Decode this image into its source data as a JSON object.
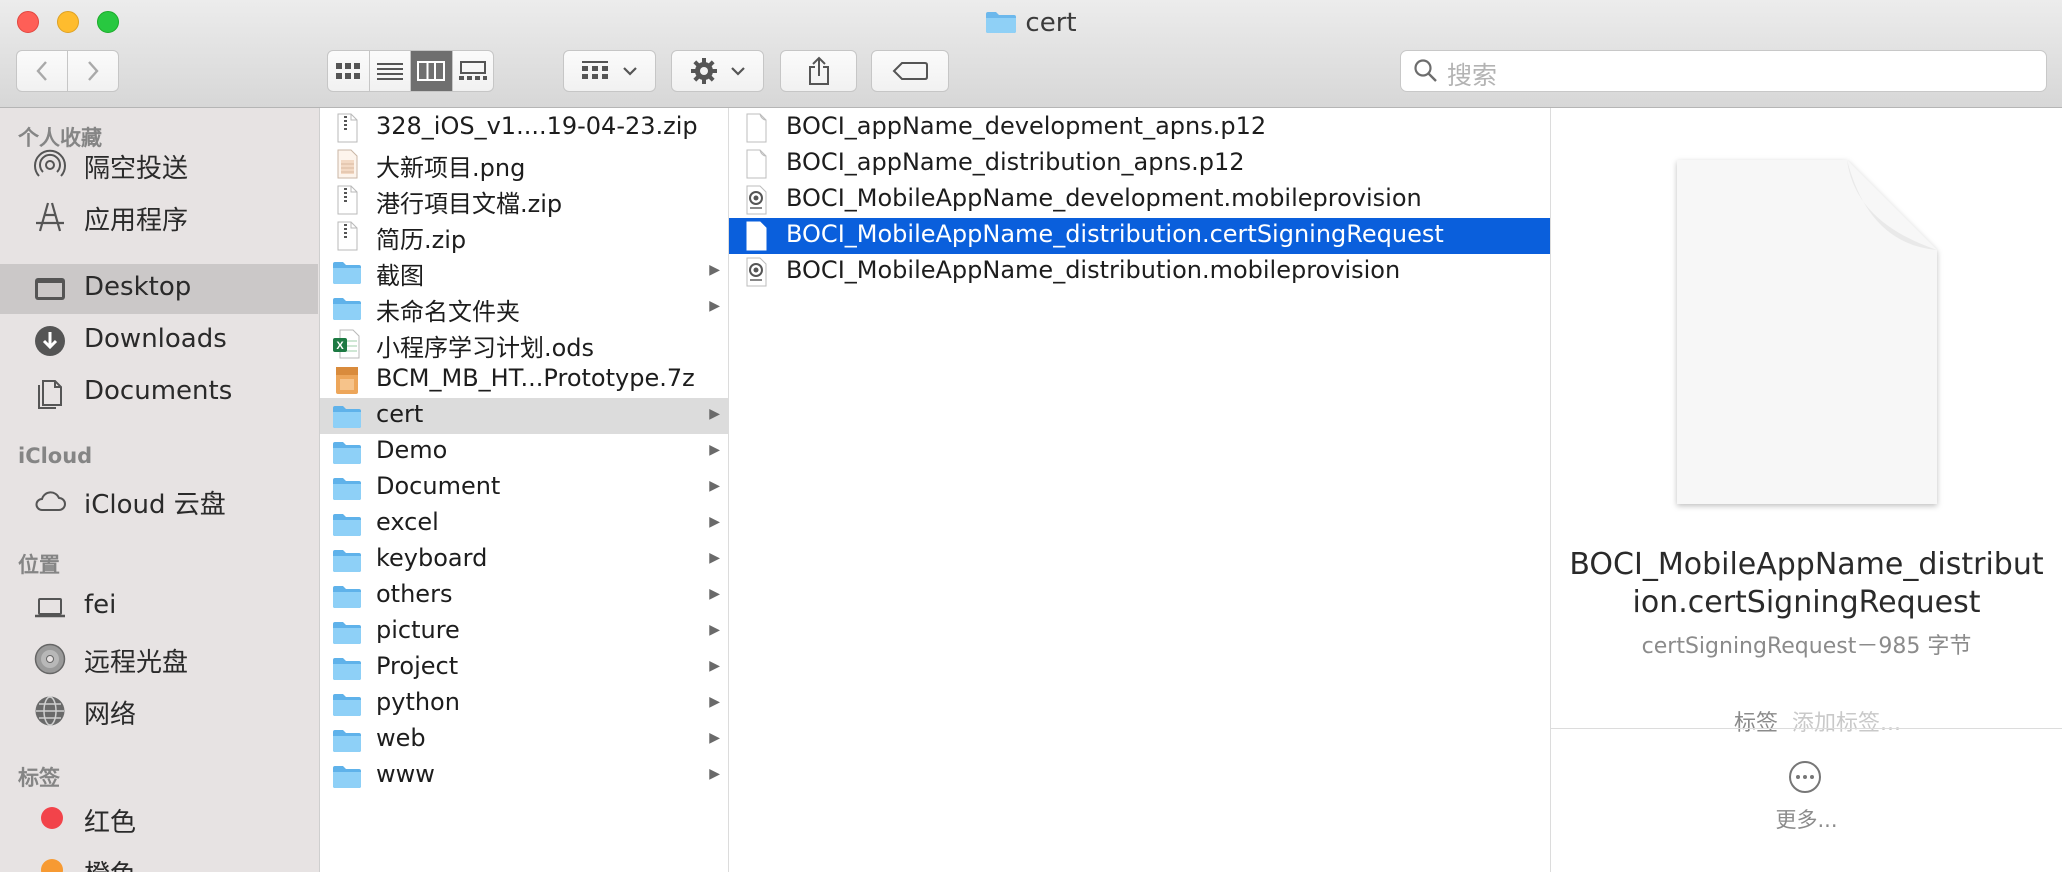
{
  "window": {
    "title": "cert",
    "title_icon": "folder-icon"
  },
  "toolbar": {
    "back_icon": "chevron-left-icon",
    "forward_icon": "chevron-right-icon",
    "view_modes": [
      "icon-view-icon",
      "list-view-icon",
      "column-view-icon",
      "gallery-view-icon"
    ],
    "active_view": "column-view-icon",
    "group_icon": "group-by-icon",
    "action_icon": "gear-icon",
    "share_icon": "share-icon",
    "tag_icon": "tag-icon",
    "search_placeholder": "搜索"
  },
  "sidebar": {
    "favorites_header": "个人收藏",
    "favorites": [
      {
        "label": "隔空投送",
        "icon": "airdrop-icon"
      },
      {
        "label": "应用程序",
        "icon": "applications-icon"
      },
      {
        "label": "Desktop",
        "icon": "desktop-icon",
        "selected": true
      },
      {
        "label": "Downloads",
        "icon": "downloads-icon"
      },
      {
        "label": "Documents",
        "icon": "documents-icon"
      }
    ],
    "icloud_header": "iCloud",
    "icloud": [
      {
        "label": "iCloud 云盘",
        "icon": "cloud-icon"
      }
    ],
    "locations_header": "位置",
    "locations": [
      {
        "label": "fei",
        "icon": "laptop-icon"
      },
      {
        "label": "远程光盘",
        "icon": "disc-icon"
      },
      {
        "label": "网络",
        "icon": "network-icon"
      }
    ],
    "tags_header": "标签",
    "tags": [
      {
        "label": "红色",
        "color": "#f2434a"
      },
      {
        "label": "橙色",
        "color": "#f79a32"
      }
    ]
  },
  "desktop_column": {
    "items": [
      {
        "name": "328_iOS_v1....19-04-23.zip",
        "icon": "zip-icon"
      },
      {
        "name": "大新项目.png",
        "icon": "image-file-icon"
      },
      {
        "name": "港行項目文檔.zip",
        "icon": "zip-icon"
      },
      {
        "name": "简历.zip",
        "icon": "zip-icon"
      },
      {
        "name": "截图",
        "icon": "folder-icon",
        "folder": true
      },
      {
        "name": "未命名文件夹",
        "icon": "folder-icon",
        "folder": true
      },
      {
        "name": "小程序学习计划.ods",
        "icon": "spreadsheet-icon"
      },
      {
        "name": "BCM_MB_HT...Prototype.7z",
        "icon": "archive-7z-icon"
      },
      {
        "name": "cert",
        "icon": "folder-icon",
        "folder": true,
        "selected": true
      },
      {
        "name": "Demo",
        "icon": "folder-icon",
        "folder": true
      },
      {
        "name": "Document",
        "icon": "folder-icon",
        "folder": true
      },
      {
        "name": "excel",
        "icon": "folder-icon",
        "folder": true
      },
      {
        "name": "keyboard",
        "icon": "folder-icon",
        "folder": true
      },
      {
        "name": "others",
        "icon": "folder-icon",
        "folder": true
      },
      {
        "name": "picture",
        "icon": "folder-icon",
        "folder": true
      },
      {
        "name": "Project",
        "icon": "folder-icon",
        "folder": true
      },
      {
        "name": "python",
        "icon": "folder-icon",
        "folder": true
      },
      {
        "name": "web",
        "icon": "folder-icon",
        "folder": true
      },
      {
        "name": "www",
        "icon": "folder-icon",
        "folder": true
      }
    ]
  },
  "cert_column": {
    "items": [
      {
        "name": "BOCI_appName_development_apns.p12",
        "icon": "document-icon"
      },
      {
        "name": "BOCI_appName_distribution_apns.p12",
        "icon": "document-icon"
      },
      {
        "name": "BOCI_MobileAppName_development.mobileprovision",
        "icon": "provision-icon"
      },
      {
        "name": "BOCI_MobileAppName_distribution.certSigningRequest",
        "icon": "document-icon",
        "selected": true
      },
      {
        "name": "BOCI_MobileAppName_distribution.mobileprovision",
        "icon": "provision-icon"
      }
    ]
  },
  "preview": {
    "name_line1": "BOCI_MobileAppName_distribut",
    "name_line2": "ion.certSigningRequest",
    "meta": "certSigningRequest－985 字节",
    "tags_label": "标签",
    "tags_placeholder": "添加标签...",
    "more_label": "更多...",
    "more_icon": "ellipsis-circle-icon"
  }
}
